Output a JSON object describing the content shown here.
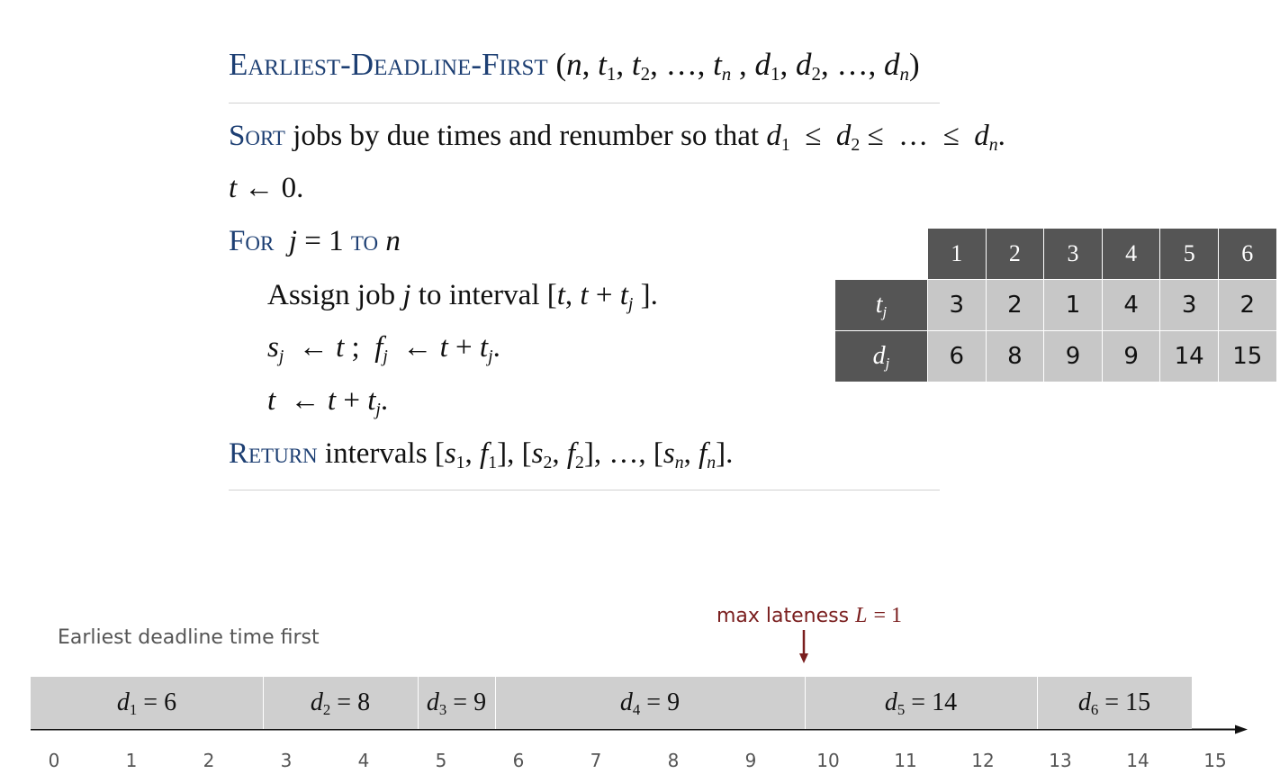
{
  "header": {
    "name": "Earliest-Deadline-First",
    "args": "(n, t1, t2, …, tn , d1, d2, …, dn)"
  },
  "algorithm": {
    "sort_kw": "Sort",
    "sort_text": "jobs by due times and renumber so that",
    "init": "t ← 0.",
    "for_kw": "For",
    "to_kw": "to",
    "assign_text": "Assign job j to interval [t, t + tj ].",
    "step_s": "sj ← t ;  fj ← t + tj.",
    "step_t": "t ← t + tj.",
    "return_kw": "Return",
    "return_text": "intervals"
  },
  "table": {
    "columns": [
      "1",
      "2",
      "3",
      "4",
      "5",
      "6"
    ],
    "rows": [
      {
        "label": "tj",
        "values": [
          "3",
          "2",
          "1",
          "4",
          "3",
          "2"
        ]
      },
      {
        "label": "dj",
        "values": [
          "6",
          "8",
          "9",
          "9",
          "14",
          "15"
        ]
      }
    ]
  },
  "timeline": {
    "caption": "Earliest deadline time first",
    "annotation_text": "max lateness",
    "annotation_var": "L",
    "annotation_value": "= 1",
    "annotation_at": 10,
    "ticks": [
      "0",
      "1",
      "2",
      "3",
      "4",
      "5",
      "6",
      "7",
      "8",
      "9",
      "10",
      "11",
      "12",
      "13",
      "14",
      "15"
    ],
    "jobs": [
      {
        "label": "d1 = 6",
        "start": 0,
        "end": 3
      },
      {
        "label": "d2 = 8",
        "start": 3,
        "end": 5
      },
      {
        "label": "d3 = 9",
        "start": 5,
        "end": 6
      },
      {
        "label": "d4 = 9",
        "start": 6,
        "end": 10
      },
      {
        "label": "d5 = 14",
        "start": 10,
        "end": 13
      },
      {
        "label": "d6 = 15",
        "start": 13,
        "end": 15
      }
    ]
  },
  "colors": {
    "keyword": "#1d3f73",
    "annotation": "#7a1e1e",
    "table_header": "#555555",
    "table_cell": "#c7c7c7",
    "job_box": "#cfcfcf"
  }
}
